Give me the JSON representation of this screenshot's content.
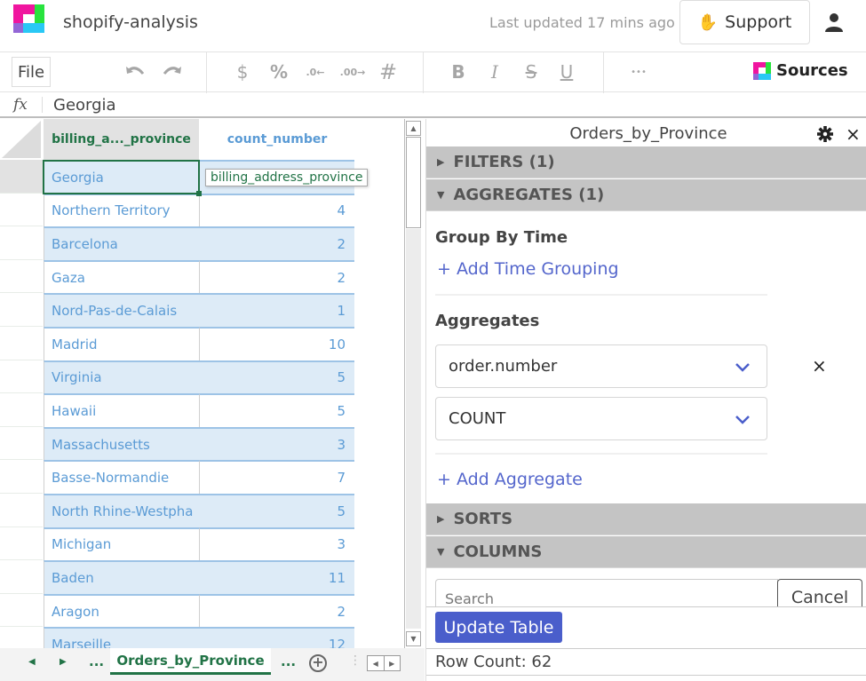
{
  "header": {
    "app_title": "shopify-analysis",
    "last_updated": "Last updated 17 mins ago",
    "support_label": "Support",
    "icons": {
      "logo": "mito-logo",
      "support": "raised-hand-icon",
      "user": "user-icon"
    }
  },
  "toolbar": {
    "file_label": "File",
    "undo_icon": "↶",
    "redo_icon": "↷",
    "currency_icon": "$",
    "percent_icon": "%",
    "decrease_decimal_icon": ".0←",
    "increase_decimal_icon": ".00→",
    "number_format_icon": "#",
    "bold_icon": "B",
    "italic_icon": "I",
    "strikethrough_icon": "S",
    "underline_icon": "U",
    "more_icon": "•••",
    "sources_label": "Sources"
  },
  "formula_bar": {
    "fx_label": "fx",
    "value": "Georgia"
  },
  "grid": {
    "columns": [
      {
        "header": "billing_a..._province",
        "full_name": "billing_address_province"
      },
      {
        "header": "count_number"
      }
    ],
    "tooltip": "billing_address_province",
    "selected_cell": {
      "row": 0,
      "column": "billing_address_province",
      "value": "Georgia"
    },
    "rows": [
      {
        "province": "Georgia",
        "count": ""
      },
      {
        "province": "Northern Territory",
        "count": "4"
      },
      {
        "province": "Barcelona",
        "count": "2"
      },
      {
        "province": "Gaza",
        "count": "2"
      },
      {
        "province": "Nord-Pas-de-Calais",
        "count": "1"
      },
      {
        "province": "Madrid",
        "count": "10"
      },
      {
        "province": "Virginia",
        "count": "5"
      },
      {
        "province": "Hawaii",
        "count": "5"
      },
      {
        "province": "Massachusetts",
        "count": "3"
      },
      {
        "province": "Basse-Normandie",
        "count": "7"
      },
      {
        "province": "North Rhine-Westpha",
        "count": "5"
      },
      {
        "province": "Michigan",
        "count": "3"
      },
      {
        "province": "Baden",
        "count": "11"
      },
      {
        "province": "Aragon",
        "count": "2"
      },
      {
        "province": "Marseille",
        "count": "12"
      }
    ]
  },
  "sheets": {
    "prev_icon": "◀",
    "next_icon": "▶",
    "more_left": "...",
    "active_tab": "Orders_by_Province",
    "more_right": "...",
    "add_icon": "+",
    "grip_icon": "⋮",
    "scroll_left_icon": "◀",
    "scroll_right_icon": "▶"
  },
  "panel": {
    "title": "Orders_by_Province",
    "sections": {
      "filters": "FILTERS (1)",
      "aggregates": "AGGREGATES (1)",
      "sorts": "SORTS",
      "columns": "COLUMNS"
    },
    "group_by_time_title": "Group By Time",
    "add_time_grouping": "+ Add Time Grouping",
    "aggregates_title": "Aggregates",
    "aggregate_column": "order.number",
    "aggregate_function": "COUNT",
    "add_aggregate": "+ Add Aggregate",
    "search_placeholder": "Search",
    "cancel_label": "Cancel",
    "update_label": "Update Table",
    "row_count": "Row Count: 62",
    "remove_icon": "×",
    "close_icon": "×"
  },
  "colors": {
    "accent_green": "#217346",
    "accent_blue": "#5466cc",
    "button_blue": "#4a5ecb",
    "cell_text_blue": "#5b9bd5",
    "band_fill": "#ddebf7",
    "section_gray": "#c4c4c4"
  }
}
